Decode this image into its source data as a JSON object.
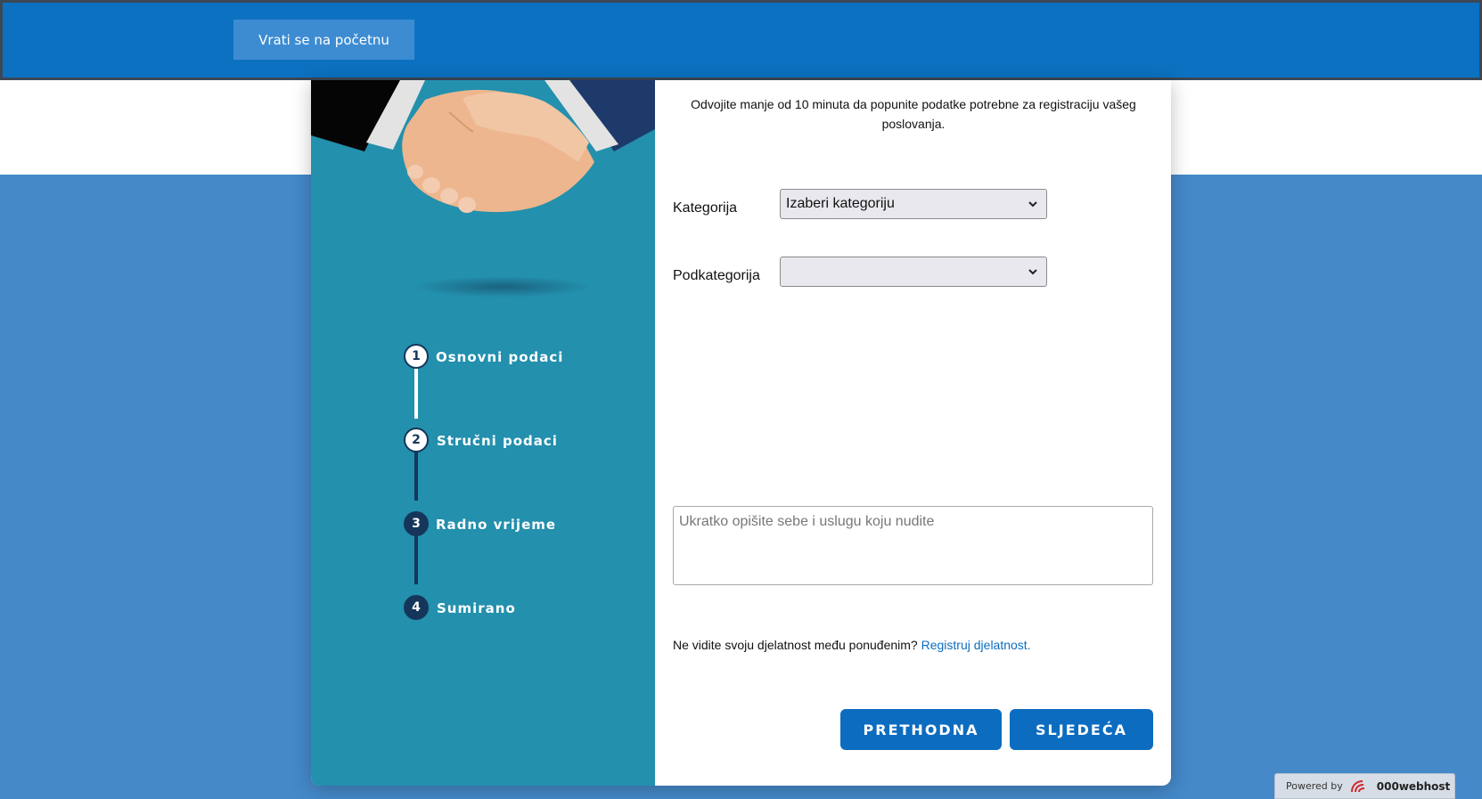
{
  "header": {
    "home_button_label": "Vrati se na početnu"
  },
  "steps": [
    {
      "number": "1",
      "label": "Osnovni podaci",
      "state": "active"
    },
    {
      "number": "2",
      "label": "Stručni podaci",
      "state": "active"
    },
    {
      "number": "3",
      "label": "Radno vrijeme",
      "state": "inactive"
    },
    {
      "number": "4",
      "label": "Sumirano",
      "state": "inactive"
    }
  ],
  "form": {
    "intro_text": "Odvojite manje od 10 minuta da popunite podatke potrebne za registraciju vašeg poslovanja.",
    "category_label": "Kategorija",
    "category_value": "Izaberi kategoriju",
    "subcategory_label": "Podkategorija",
    "subcategory_value": "",
    "description_placeholder": "Ukratko opišite sebe i uslugu koju nudite",
    "register_prompt": "Ne vidite svoju djelatnost među ponuđenim?",
    "register_link": "Registruj djelatnost.",
    "prev_button": "PRETHODNA",
    "next_button": "SLJEDEĆA"
  },
  "footer": {
    "powered_by": "Powered by",
    "brand": "000webhost"
  },
  "colors": {
    "header_bg": "#0c71c0",
    "page_bg": "#4589c9",
    "sidebar_bg": "#2390ad",
    "primary_button": "#0c6cc0",
    "step_dark": "#15365a"
  }
}
